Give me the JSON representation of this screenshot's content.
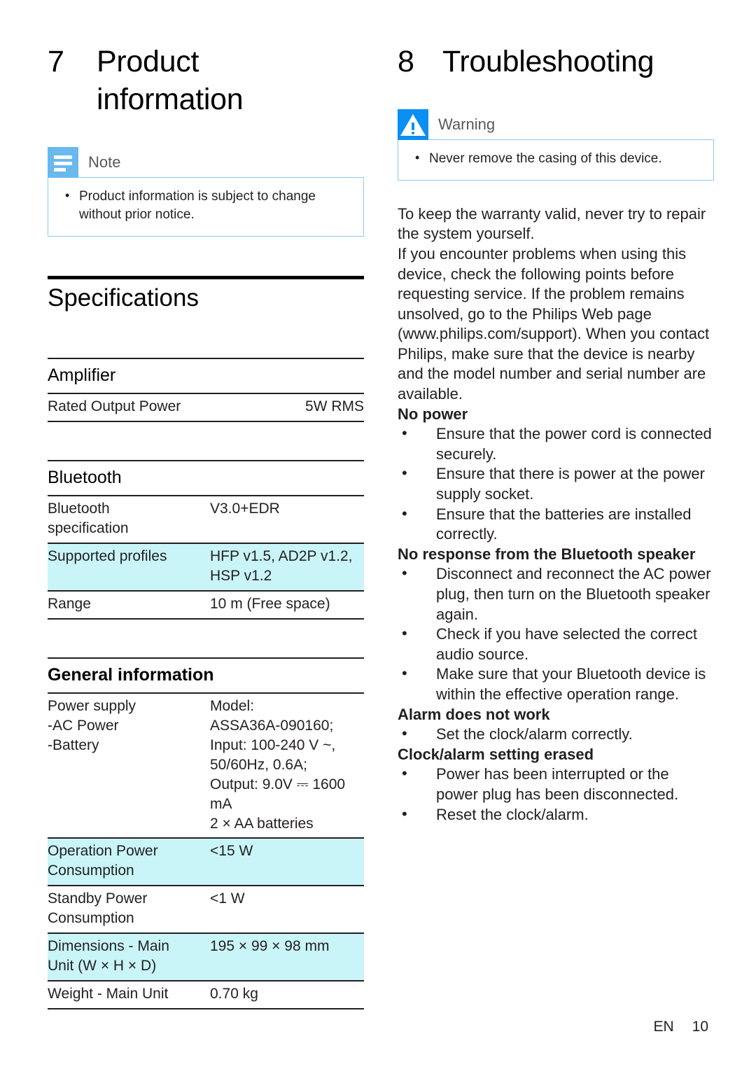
{
  "colors": {
    "note_icon": "#69b9ee",
    "warning_icon": "#0b8ff2",
    "callout_border": "#8cc9f0",
    "row_highlight": "#c9f5f8"
  },
  "left": {
    "chapter": {
      "number": "7",
      "title_line1": "Product",
      "title_line2": "information"
    },
    "note": {
      "icon": "note-icon",
      "label": "Note",
      "items": [
        "Product information is subject to change without prior notice."
      ]
    },
    "specifications": {
      "title": "Specifications",
      "blocks": [
        {
          "title": "Amplifier",
          "bold_title": false,
          "value_align": "right",
          "rows": [
            {
              "label": "Rated Output Power",
              "value": "5W RMS",
              "highlight": false
            }
          ]
        },
        {
          "title": "Bluetooth",
          "bold_title": false,
          "value_align": "left",
          "rows": [
            {
              "label": "Bluetooth\nspecification",
              "value": "V3.0+EDR",
              "highlight": false
            },
            {
              "label": "Supported profiles",
              "value": "HFP v1.5, AD2P v1.2,\nHSP v1.2",
              "highlight": true
            },
            {
              "label": "Range",
              "value": "10 m (Free space)",
              "highlight": false
            }
          ]
        },
        {
          "title": "General information",
          "bold_title": true,
          "value_align": "left",
          "rows": [
            {
              "label": "Power supply\n-AC Power\n-Battery",
              "value": "Model:\nASSA36A-090160;\nInput: 100-240 V ~,\n50/60Hz, 0.6A;\n Output: 9.0V ⎓ 1600\nmA\n2 × AA batteries",
              "highlight": false
            },
            {
              "label": "Operation Power\nConsumption",
              "value": "<15 W",
              "highlight": true
            },
            {
              "label": "Standby Power\nConsumption",
              "value": "<1 W",
              "highlight": false
            },
            {
              "label": "Dimensions - Main\nUnit (W × H × D)",
              "value": "195 × 99 × 98 mm",
              "highlight": true
            },
            {
              "label": "Weight - Main Unit",
              "value": "0.70 kg",
              "highlight": false
            }
          ]
        }
      ]
    }
  },
  "right": {
    "chapter": {
      "number": "8",
      "title": "Troubleshooting"
    },
    "warning": {
      "icon": "warning-icon",
      "label": "Warning",
      "items": [
        "Never remove the casing of this device."
      ]
    },
    "intro": "To keep the warranty valid, never try to repair the system yourself.\nIf you encounter problems when using this device, check the following points before requesting service. If the problem remains unsolved, go to the Philips Web page (www.philips.com/support). When you contact Philips, make sure that the device is nearby and the model number and serial number are available.",
    "sections": [
      {
        "heading": "No power",
        "items": [
          "Ensure that the power cord is connected securely.",
          "Ensure that there is power at the power supply socket.",
          "Ensure that the batteries are installed correctly."
        ]
      },
      {
        "heading": "No response from the Bluetooth speaker",
        "items": [
          "Disconnect and reconnect the AC power plug, then turn on the Bluetooth speaker again.",
          "Check if you have selected the correct audio source.",
          "Make sure that your Bluetooth device is within the effective operation range."
        ]
      },
      {
        "heading": "Alarm does not work",
        "items": [
          "Set the clock/alarm correctly."
        ]
      },
      {
        "heading": "Clock/alarm setting erased",
        "items": [
          "Power has been interrupted or the power plug has been disconnected.",
          "Reset the clock/alarm."
        ]
      }
    ]
  },
  "footer": {
    "language": "EN",
    "page": "10"
  }
}
